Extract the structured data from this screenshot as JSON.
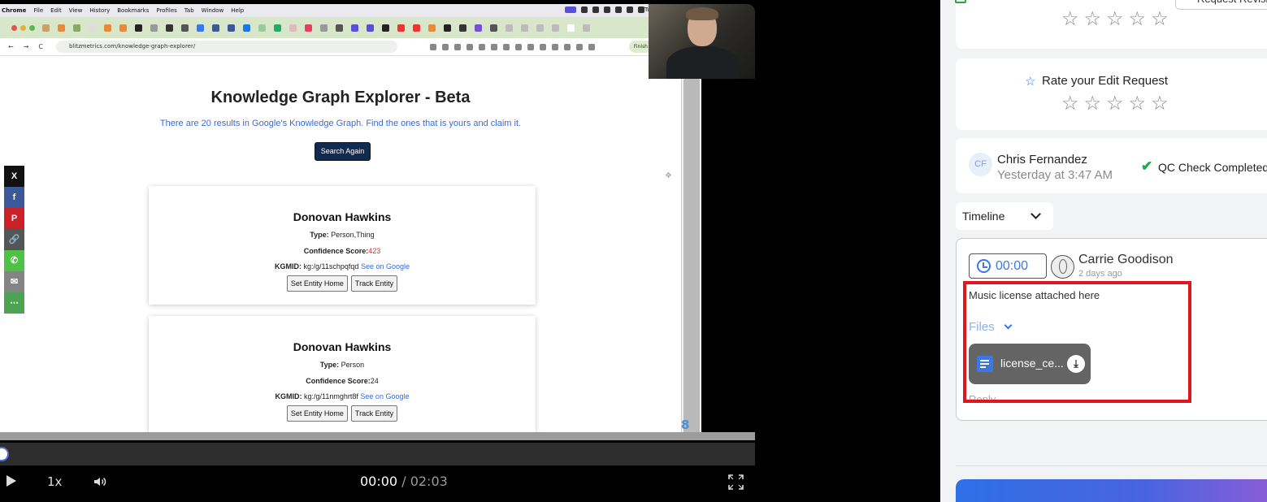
{
  "mac_menubar": {
    "items": [
      "Chrome",
      "File",
      "Edit",
      "View",
      "History",
      "Bookmarks",
      "Profiles",
      "Tab",
      "Window",
      "Help"
    ],
    "clock": "Tu"
  },
  "browser": {
    "url": "blitzmetrics.com/knowledge-graph-explorer/",
    "finish_label": "Finish"
  },
  "kge": {
    "title": "Knowledge Graph Explorer - Beta",
    "subtitle": "There are 20 results in Google's Knowledge Graph. Find the ones that is yours and claim it.",
    "search_again_label": "Search Again",
    "type_label": "Type:",
    "confidence_label": "Confidence Score:",
    "kgmid_label": "KGMID:",
    "see_on_google": "See on Google",
    "set_entity_home": "Set Entity Home",
    "track_entity": "Track Entity",
    "results": [
      {
        "name": "Donovan Hawkins",
        "type": "Person,Thing",
        "confidence": "423",
        "kgmid": "kg:/g/11schpqfqd"
      },
      {
        "name": "Donovan Hawkins",
        "type": "Person",
        "confidence": "24",
        "kgmid": "kg:/g/11nmghrt8f"
      }
    ],
    "page_number": "8"
  },
  "share_bar": [
    {
      "icon": "x-icon",
      "glyph": "X",
      "color": "#111111"
    },
    {
      "icon": "facebook-icon",
      "glyph": "f",
      "color": "#3b5998"
    },
    {
      "icon": "pinterest-icon",
      "glyph": "P",
      "color": "#cb2027"
    },
    {
      "icon": "copy-link-icon",
      "glyph": "🔗",
      "color": "#555555"
    },
    {
      "icon": "whatsapp-icon",
      "glyph": "✆",
      "color": "#4dc247"
    },
    {
      "icon": "email-icon",
      "glyph": "✉",
      "color": "#848484"
    },
    {
      "icon": "more-share-icon",
      "glyph": "⋯",
      "color": "#4ca351"
    }
  ],
  "player": {
    "speed": "1x",
    "current_time": "00:00",
    "separator": "/",
    "duration": "02:03",
    "progress": 0
  },
  "panel": {
    "top_button_label": "Request Revision",
    "rate_title": "Rate your Edit Request",
    "qc": {
      "initials": "CF",
      "name": "Chris Fernandez",
      "time": "Yesterday at 3:47 AM",
      "status": "QC Check Completed"
    },
    "timeline_label": "Timeline",
    "comment": {
      "timestamp": "00:00",
      "author": "Carrie Goodison",
      "time": "2 days ago",
      "message": "Music license attached here",
      "files_label": "Files",
      "file_name": "license_ce...",
      "reply_label": "Reply"
    },
    "accent_color": "#3b78e7",
    "highlight_color": "#e0161e"
  }
}
